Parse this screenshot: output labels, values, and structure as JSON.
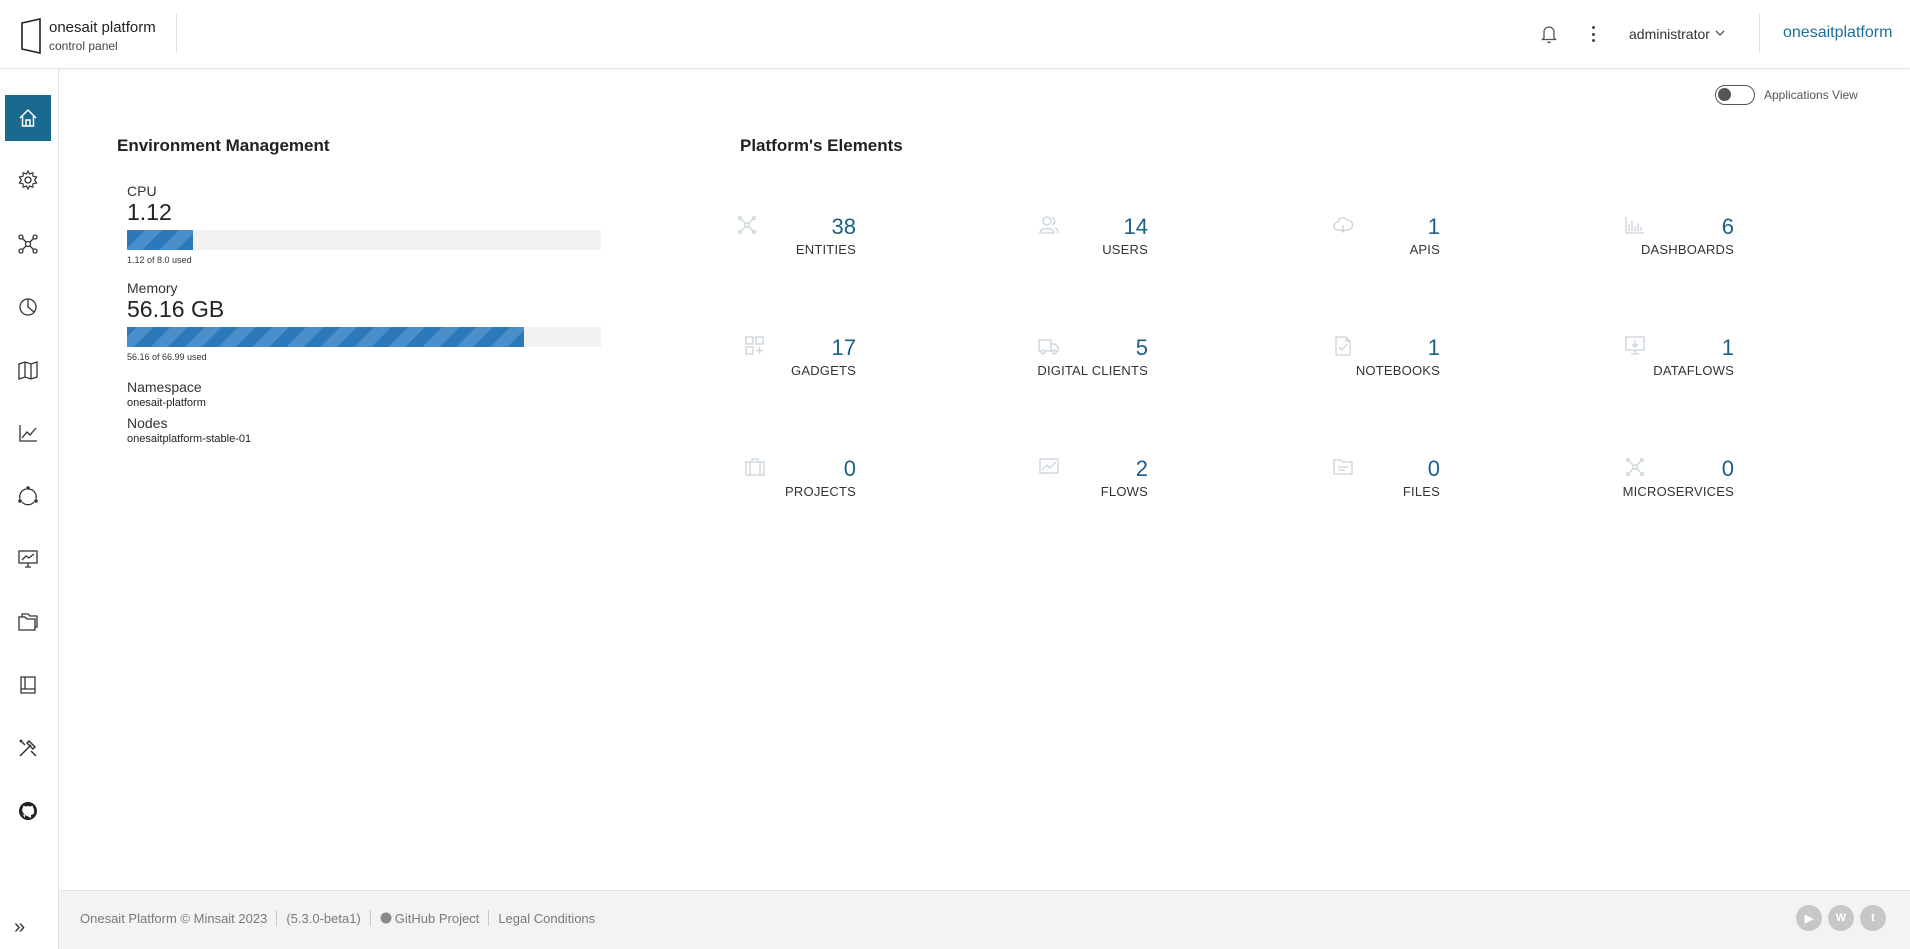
{
  "header": {
    "brand_line1": "onesait platform",
    "brand_line2": "control panel",
    "user": "administrator",
    "platform_link": "onesaitplatform"
  },
  "sidebar": {
    "items": [
      {
        "icon": "home-icon",
        "active": true
      },
      {
        "icon": "gear-icon"
      },
      {
        "icon": "network-icon"
      },
      {
        "icon": "pie-chart-icon"
      },
      {
        "icon": "map-icon"
      },
      {
        "icon": "line-chart-icon"
      },
      {
        "icon": "cycle-icon"
      },
      {
        "icon": "monitor-chart-icon"
      },
      {
        "icon": "folders-icon"
      },
      {
        "icon": "book-icon"
      },
      {
        "icon": "tools-icon"
      },
      {
        "icon": "github-icon"
      }
    ],
    "expand_label": "»"
  },
  "toggle": {
    "label": "Applications View",
    "on": false
  },
  "environment": {
    "title": "Environment Management",
    "cpu": {
      "label": "CPU",
      "value": "1.12",
      "note": "1.12 of 8.0 used",
      "fraction": 0.14
    },
    "memory": {
      "label": "Memory",
      "value": "56.16 GB",
      "note": "56.16 of 66.99 used",
      "fraction": 0.8383
    },
    "namespace": {
      "label": "Namespace",
      "value": "onesait-platform"
    },
    "nodes": {
      "label": "Nodes",
      "value": "onesaitplatform-stable-01"
    }
  },
  "elements": {
    "title": "Platform's Elements",
    "tiles": [
      {
        "icon": "entities-icon",
        "count": "38",
        "label": "ENTITIES"
      },
      {
        "icon": "users-icon",
        "count": "14",
        "label": "USERS"
      },
      {
        "icon": "cloud-icon",
        "count": "1",
        "label": "APIS"
      },
      {
        "icon": "dashboard-icon",
        "count": "6",
        "label": "DASHBOARDS"
      },
      {
        "icon": "gadgets-icon",
        "count": "17",
        "label": "GADGETS"
      },
      {
        "icon": "truck-icon",
        "count": "5",
        "label": "DIGITAL CLIENTS"
      },
      {
        "icon": "notebook-icon",
        "count": "1",
        "label": "NOTEBOOKS"
      },
      {
        "icon": "dataflow-icon",
        "count": "1",
        "label": "DATAFLOWS"
      },
      {
        "icon": "briefcase-icon",
        "count": "0",
        "label": "PROJECTS"
      },
      {
        "icon": "flows-icon",
        "count": "2",
        "label": "FLOWS"
      },
      {
        "icon": "folder-icon",
        "count": "0",
        "label": "FILES"
      },
      {
        "icon": "microservices-icon",
        "count": "0",
        "label": "MICROSERVICES"
      }
    ]
  },
  "footer": {
    "copyright": "Onesait Platform © Minsait 2023",
    "version": "(5.3.0-beta1)",
    "github": "GitHub Project",
    "legal": "Legal Conditions",
    "socials": [
      {
        "icon": "youtube-icon",
        "glyph": "▶"
      },
      {
        "icon": "wordpress-icon",
        "glyph": "W"
      },
      {
        "icon": "twitter-icon",
        "glyph": "t"
      }
    ]
  },
  "colors": {
    "accent": "#1a6a8f",
    "count": "#1b5f86",
    "bar": "#2c78b8"
  }
}
